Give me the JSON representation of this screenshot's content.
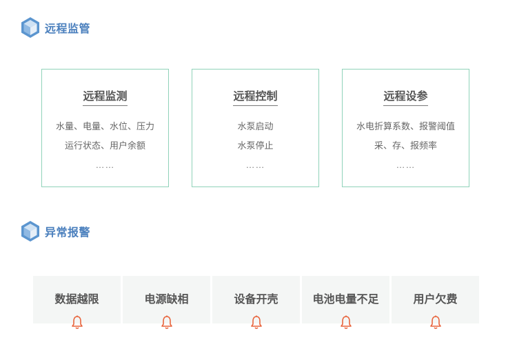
{
  "remote": {
    "title": "远程监管",
    "icon": "cube-icon",
    "cards": [
      {
        "title": "远程监测",
        "lines": [
          "水量、电量、水位、压力",
          "运行状态、用户余额"
        ],
        "more": "……"
      },
      {
        "title": "远程控制",
        "lines": [
          "水泵启动",
          "水泵停止"
        ],
        "more": "……"
      },
      {
        "title": "远程设参",
        "lines": [
          "水电折算系数、报警阈值",
          "采、存、报频率"
        ],
        "more": "……"
      }
    ]
  },
  "alarm": {
    "title": "异常报警",
    "icon": "cube-icon",
    "bell_icon": "bell-icon",
    "bell_color": "#e8643c",
    "items": [
      {
        "label": "数据越限"
      },
      {
        "label": "电源缺相"
      },
      {
        "label": "设备开壳"
      },
      {
        "label": "电池电量不足"
      },
      {
        "label": "用户欠费"
      }
    ]
  },
  "colors": {
    "accent": "#4a7fbd",
    "card_border": "#8fd2b9",
    "tile_bg": "#f4f6f5"
  }
}
